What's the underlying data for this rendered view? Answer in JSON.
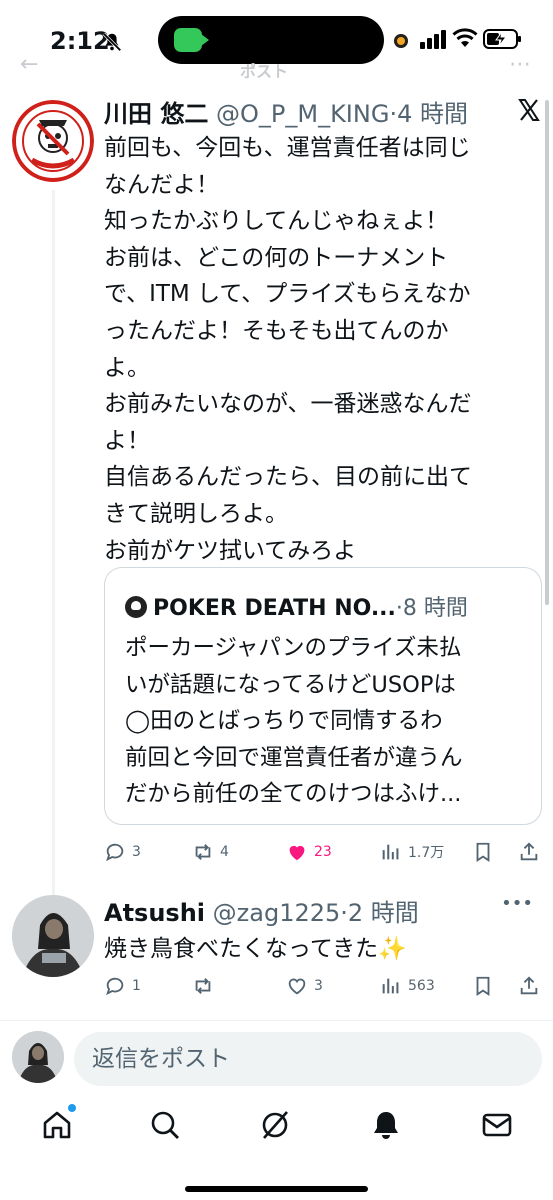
{
  "status_bar": {
    "time": "2:12"
  },
  "header": {
    "title": "ポスト"
  },
  "main_tweet": {
    "author_name": "川田 悠二",
    "handle": "@O_P_M_KING",
    "time": "·4 時間",
    "avatar_icon": "opm-family-logo",
    "avatar_text": "O.P.M. Family",
    "lines": [
      "前回も、今回も、運営責任者は同じ",
      "なんだよ！",
      "知ったかぶりしてんじゃねぇよ！",
      "お前は、どこの何のトーナメント",
      "で、ITM して、プライズもらえなか",
      "ったんだよ！そもそも出てんのか",
      "よ。",
      "お前みたいなのが、一番迷惑なんだ",
      "よ！",
      "自信あるんだったら、目の前に出て",
      "きて説明しろよ。",
      "お前がケツ拭いてみろよ"
    ],
    "quote": {
      "icon": "skull-icon",
      "author_name": "POKER DEATH NO...",
      "time": "·8 時間",
      "lines": [
        "ポーカージャパンのプライズ未払",
        "いが話題になってるけどUSOPは",
        "◯田のとばっちりで同情するわ",
        "前回と今回で運営責任者が違うん",
        "だから前任の全てのけつはふけ..."
      ]
    },
    "actions": {
      "replies": "3",
      "reposts": "4",
      "likes": "23",
      "views": "1.7万"
    }
  },
  "reply": {
    "author_name": "Atsushi",
    "handle": "@zag1225",
    "time": "·2 時間",
    "text": "焼き鳥食べたくなってきた✨",
    "actions": {
      "replies": "1",
      "reposts": "",
      "likes": "3",
      "views": "563"
    }
  },
  "compose": {
    "placeholder": "返信をポスト"
  },
  "colors": {
    "text": "#0f1419",
    "muted": "#536471",
    "like": "#f91880",
    "accent": "#1d9bf0",
    "border": "#cfd9de"
  }
}
